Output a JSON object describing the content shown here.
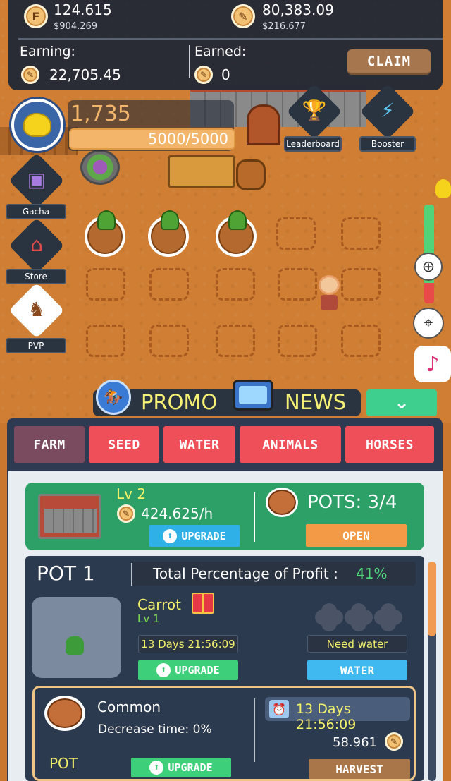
{
  "hud": {
    "token_balance": "124.615",
    "token_usd": "$904.269",
    "token_icon": "F",
    "gem_balance": "80,383.09",
    "gem_usd": "$216.677",
    "earning_label": "Earning:",
    "earning_value": "22,705.45",
    "earned_label": "Earned:",
    "earned_value": "0",
    "claim_label": "CLAIM"
  },
  "player": {
    "energy": "1,735",
    "energy_bar": "5000/5000",
    "energy_fill_fraction": 1.0
  },
  "side_menu": {
    "leaderboard": "Leaderboard",
    "booster": "Booster",
    "gacha": "Gacha",
    "store": "Store",
    "pvp": "PVP",
    "zoom_level_fraction": 0.79
  },
  "promo": {
    "promo_label": "PROMO",
    "news_label": "NEWS"
  },
  "tabs": [
    {
      "label": "FARM"
    },
    {
      "label": "SEED"
    },
    {
      "label": "WATER"
    },
    {
      "label": "ANIMALS"
    },
    {
      "label": "HORSES"
    }
  ],
  "farm": {
    "level": "Lv 2",
    "rate": "424.625/h",
    "upgrade_label": "UPGRADE",
    "pots_label": "POTS: 3/4",
    "open_label": "OPEN"
  },
  "pot1": {
    "title": "POT 1",
    "profit_label": "Total Percentage of Profit :",
    "profit_value": "41%",
    "crop_name": "Carrot",
    "crop_level": "Lv 1",
    "timer": "13 Days 21:56:09",
    "need_water": "Need water",
    "upgrade_label": "UPGRADE",
    "water_label": "WATER"
  },
  "pot_detail": {
    "rarity": "Common",
    "decrease": "Decrease time: 0%",
    "pot_label": "POT",
    "upgrade_label": "UPGRADE",
    "timer": "13 Days 21:56:09",
    "amount": "58.961",
    "harvest_label": "HARVEST"
  },
  "colors": {
    "tab_active": "#7a4a5e",
    "tab_inactive": "#ef4f58",
    "farm_card": "#2da067",
    "accent_yellow": "#f3f06a",
    "profit_green": "#4fd97b"
  }
}
